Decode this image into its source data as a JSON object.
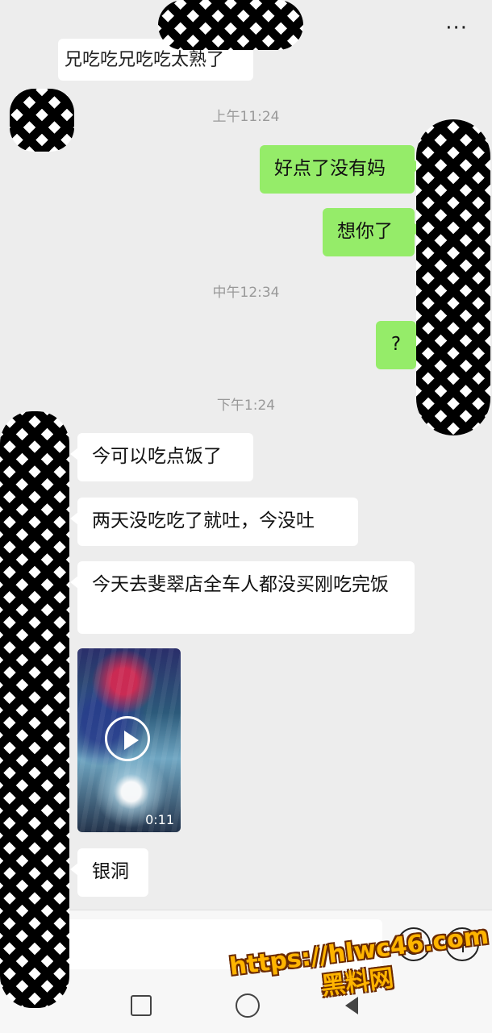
{
  "header": {
    "more_glyph": "···"
  },
  "partial_message": "兄吃吃兄吃吃太熟了",
  "timestamps": [
    "上午11:24",
    "中午12:34",
    "下午1:24"
  ],
  "messages_out": [
    "好点了没有妈",
    "想你了",
    "?"
  ],
  "messages_in": [
    "今可以吃点饭了",
    "两天没吃吃了就吐，今没吐",
    "今天去斐翠店全车人都没买刚吃完饭",
    "银洞"
  ],
  "video": {
    "duration": "0:11"
  },
  "watermark": {
    "line1": "https://hlwc46.com",
    "line2": "黑料网"
  },
  "icons": [
    "more-icon",
    "play-icon",
    "emoji-icon",
    "plus-icon",
    "nav-square-icon",
    "nav-circle-icon",
    "nav-back-icon"
  ]
}
